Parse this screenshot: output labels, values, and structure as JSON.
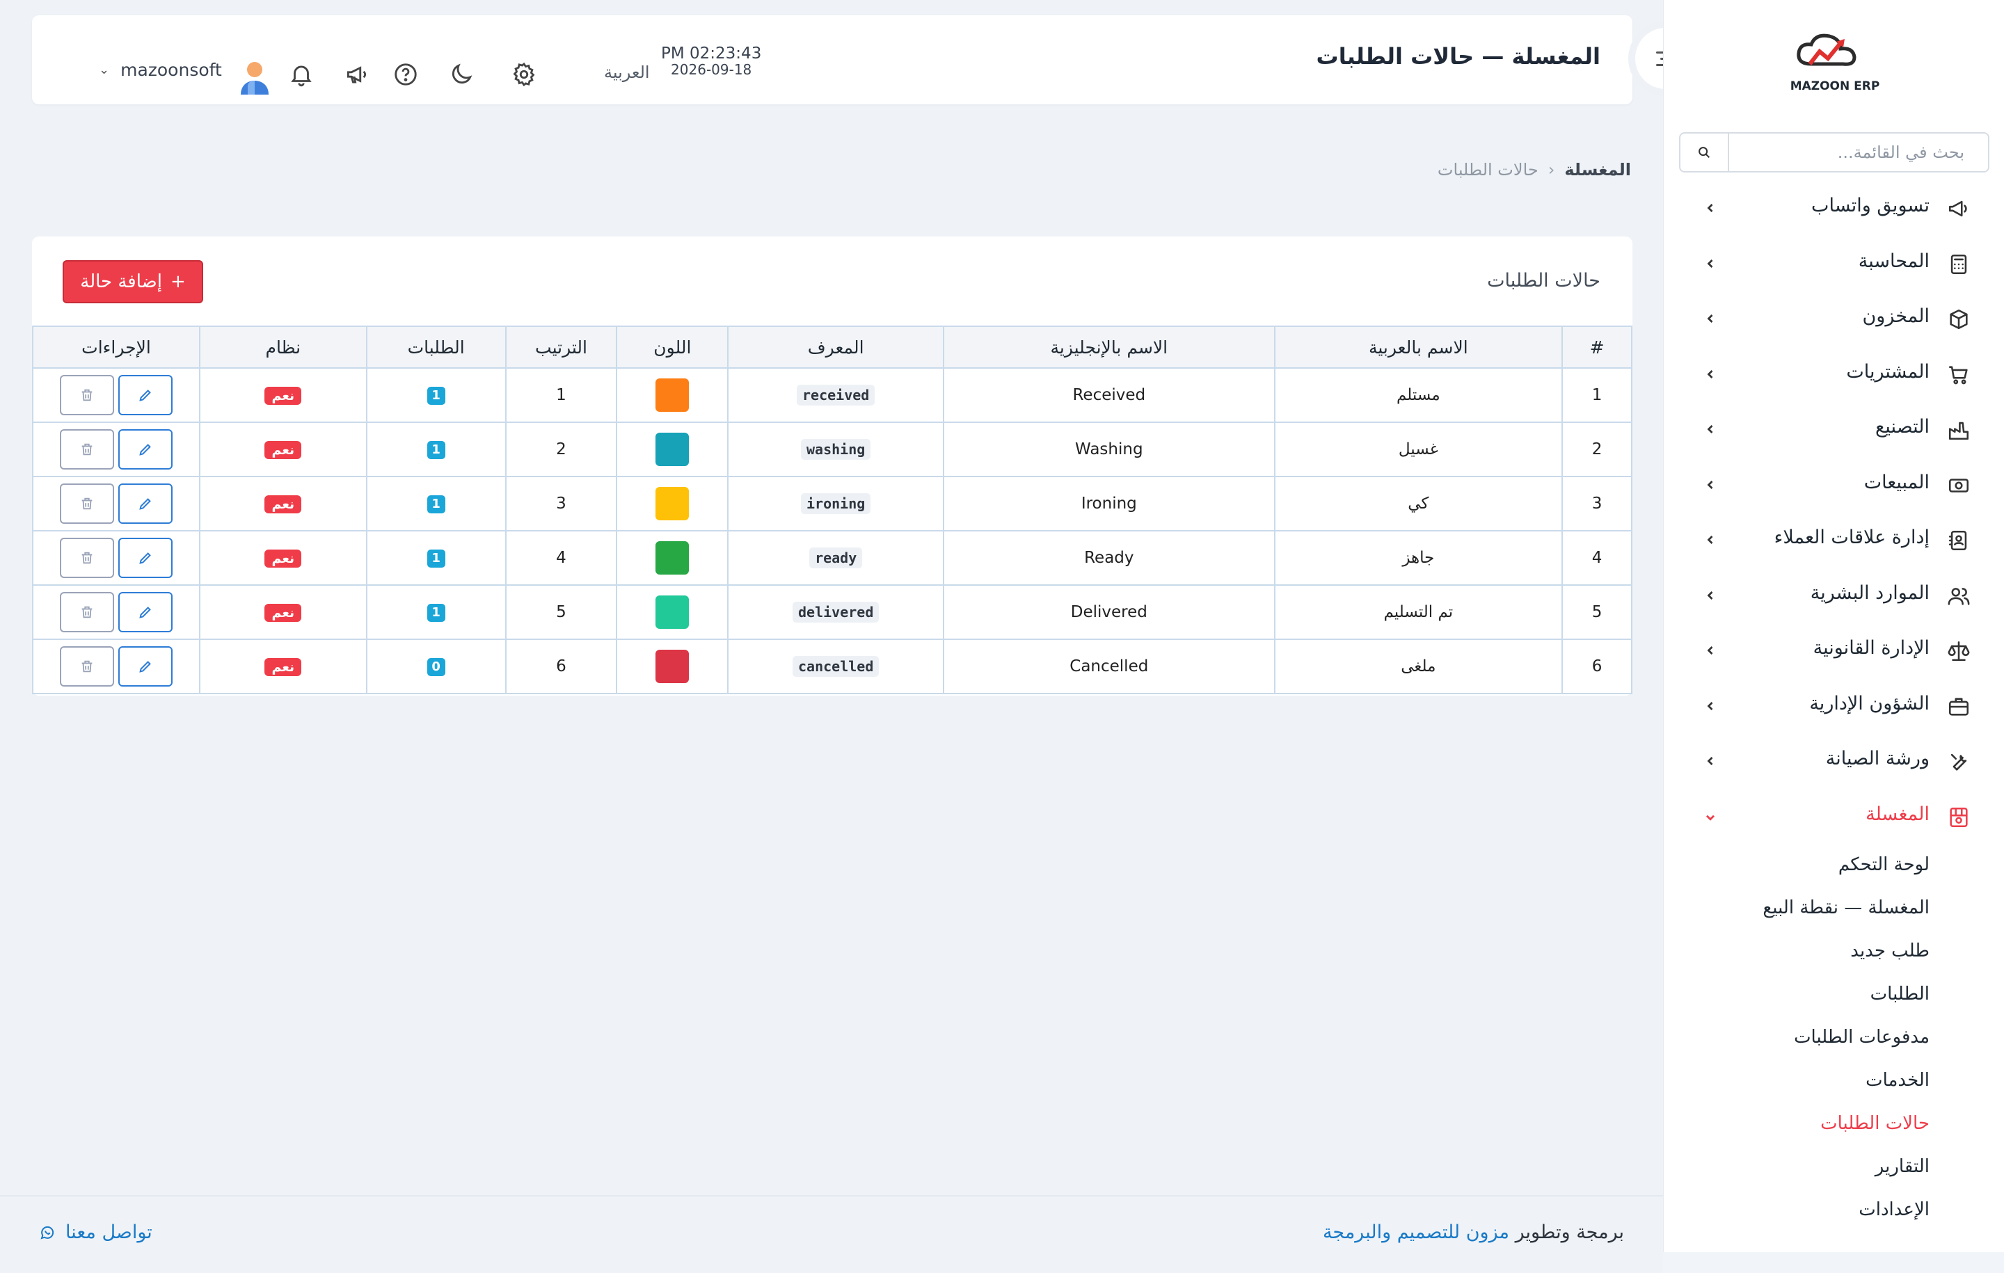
{
  "header": {
    "page_title": "المغسلة — حالات الطلبات",
    "time": "PM 02:23:43",
    "date": "2026-09-18",
    "language": "العربية",
    "username": "mazoonsoft"
  },
  "breadcrumb": {
    "parent": "المغسلة",
    "current": "حالات الطلبات"
  },
  "card": {
    "title": "حالات الطلبات",
    "add_button": "إضافة حالة",
    "add_icon": "+"
  },
  "table": {
    "columns": [
      "#",
      "الاسم بالعربية",
      "الاسم بالإنجليزية",
      "المعرف",
      "اللون",
      "الترتيب",
      "الطلبات",
      "نظام",
      "الإجراءات"
    ],
    "rows": [
      {
        "num": "1",
        "ar": "مستلم",
        "en": "Received",
        "key": "received",
        "color": "#fd7e14",
        "order": "1",
        "orders": "1",
        "system": "نعم"
      },
      {
        "num": "2",
        "ar": "غسيل",
        "en": "Washing",
        "key": "washing",
        "color": "#17a2b8",
        "order": "2",
        "orders": "1",
        "system": "نعم"
      },
      {
        "num": "3",
        "ar": "كي",
        "en": "Ironing",
        "key": "ironing",
        "color": "#ffc107",
        "order": "3",
        "orders": "1",
        "system": "نعم"
      },
      {
        "num": "4",
        "ar": "جاهز",
        "en": "Ready",
        "key": "ready",
        "color": "#28a745",
        "order": "4",
        "orders": "1",
        "system": "نعم"
      },
      {
        "num": "5",
        "ar": "تم التسليم",
        "en": "Delivered",
        "key": "delivered",
        "color": "#20c997",
        "order": "5",
        "orders": "1",
        "system": "نعم"
      },
      {
        "num": "6",
        "ar": "ملغى",
        "en": "Cancelled",
        "key": "cancelled",
        "color": "#dc3545",
        "order": "6",
        "orders": "0",
        "system": "نعم"
      }
    ]
  },
  "sidebar": {
    "brand": "MAZOON ERP",
    "search_placeholder": "بحث في القائمة...",
    "items": [
      {
        "label": "تسويق واتساب",
        "icon": "megaphone-icon"
      },
      {
        "label": "المحاسبة",
        "icon": "calculator-icon"
      },
      {
        "label": "المخزون",
        "icon": "box-icon"
      },
      {
        "label": "المشتريات",
        "icon": "cart-icon"
      },
      {
        "label": "التصنيع",
        "icon": "factory-icon"
      },
      {
        "label": "المبيعات",
        "icon": "cash-icon"
      },
      {
        "label": "إدارة علاقات العملاء",
        "icon": "contacts-icon"
      },
      {
        "label": "الموارد البشرية",
        "icon": "users-icon"
      },
      {
        "label": "الإدارة القانونية",
        "icon": "scale-icon"
      },
      {
        "label": "الشؤون الإدارية",
        "icon": "briefcase-icon"
      },
      {
        "label": "ورشة الصيانة",
        "icon": "wrench-icon"
      },
      {
        "label": "المغسلة",
        "icon": "laundry-icon"
      }
    ],
    "sub_items": [
      "لوحة التحكم",
      "المغسلة — نقطة البيع",
      "طلب جديد",
      "الطلبات",
      "مدفوعات الطلبات",
      "الخدمات",
      "حالات الطلبات",
      "التقارير",
      "الإعدادات"
    ]
  },
  "footer": {
    "credit_prefix": "برمجة وتطوير",
    "credit_link": "مزون للتصميم والبرمجة",
    "contact": "تواصل معنا"
  },
  "colors": {
    "accent": "#ee3d4a",
    "link": "#1a7ac7",
    "badge_count": "#1aa6d8"
  }
}
